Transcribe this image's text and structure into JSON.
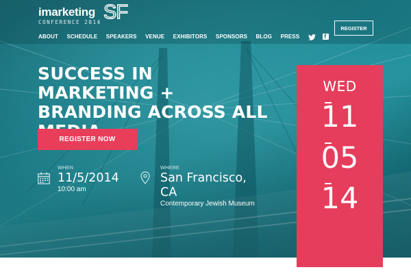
{
  "logo": {
    "word": "imarketing",
    "mark": "SF",
    "subtitle": "CONFERENCE 2014"
  },
  "nav": {
    "items": [
      "ABOUT",
      "SCHEDULE",
      "SPEAKERS",
      "VENUE",
      "EXHIBITORS",
      "SPONSORS",
      "BLOG",
      "PRESS"
    ],
    "social_icons": [
      "twitter-icon",
      "facebook-icon"
    ]
  },
  "header": {
    "register_label": "REGISTER"
  },
  "hero": {
    "headline": "SUCCESS IN MARKETING + BRANDING ACROSS ALL MEDIA",
    "cta_label": "REGISTER NOW",
    "when": {
      "label": "WHEN",
      "date": "11/5/2014",
      "time": "10:00 am",
      "icon": "calendar-icon"
    },
    "where": {
      "label": "WHERE",
      "city": "San Francisco, CA",
      "venue": "Contemporary Jewish Museum",
      "icon": "map-pin-icon"
    }
  },
  "date_card": {
    "day": "WED",
    "month": "11",
    "date": "05",
    "year": "14"
  },
  "colors": {
    "accent": "#e83e5a",
    "hero_teal": "#1f8a96",
    "text": "#ffffff"
  }
}
